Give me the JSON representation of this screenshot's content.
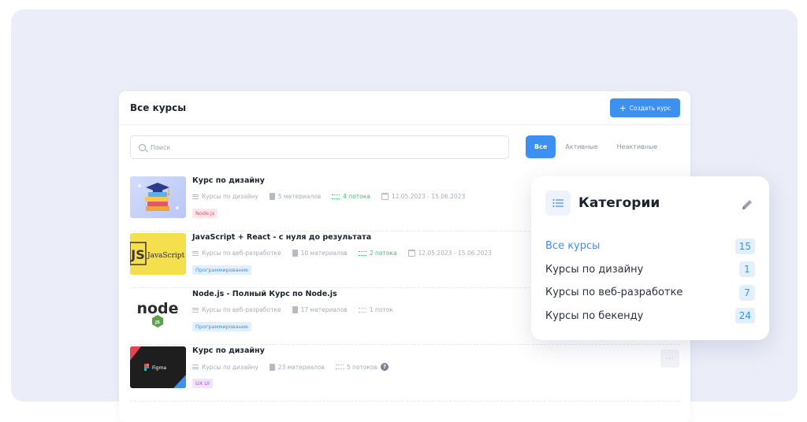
{
  "header": {
    "title": "Все курсы",
    "create_button": "Создать курс"
  },
  "search": {
    "placeholder": "Поиск"
  },
  "filters": [
    "Все",
    "Активные",
    "Неактивные"
  ],
  "courses": [
    {
      "title": "Курс по дизайну",
      "category": "Курсы по дизайну",
      "materials": "5 материалов",
      "streams": "4 потока",
      "dates": "12.05.2023 - 15.06.2023",
      "tag": "Node.js",
      "thumb": "design-books-graduation-cap"
    },
    {
      "title": "JavaScript + React - с нуля до результата",
      "category": "Курсы по веб-разработке",
      "materials": "10 материалов",
      "streams": "2 потока",
      "dates": "12.05.2023 - 15.06.2023",
      "tag": "Программирование",
      "thumb_label": "JavaScript"
    },
    {
      "title": "Node.js - Полный Курс по Node.js",
      "category": "Курсы по веб-разработке",
      "materials": "17 материалов",
      "streams": "1 поток",
      "tag": "Программирование",
      "thumb_label": "node",
      "thumb_badge": "JS"
    },
    {
      "title": "Курс по дизайну",
      "category": "Курсы по дизайну",
      "materials": "23 материалов",
      "streams": "5 потоков",
      "tag": "UX UI",
      "thumb_label": "Figma",
      "more_button": "···"
    }
  ],
  "categories": {
    "title": "Категории",
    "items": [
      {
        "label": "Все курсы",
        "count": "15"
      },
      {
        "label": "Курсы по дизайну",
        "count": "1"
      },
      {
        "label": "Курсы по веб-разработке",
        "count": "7"
      },
      {
        "label": "Курсы по бекенду",
        "count": "24"
      }
    ]
  },
  "colors": {
    "accent": "#3d8ff0",
    "background": "#ebedf8",
    "success": "#3bbf6e"
  }
}
